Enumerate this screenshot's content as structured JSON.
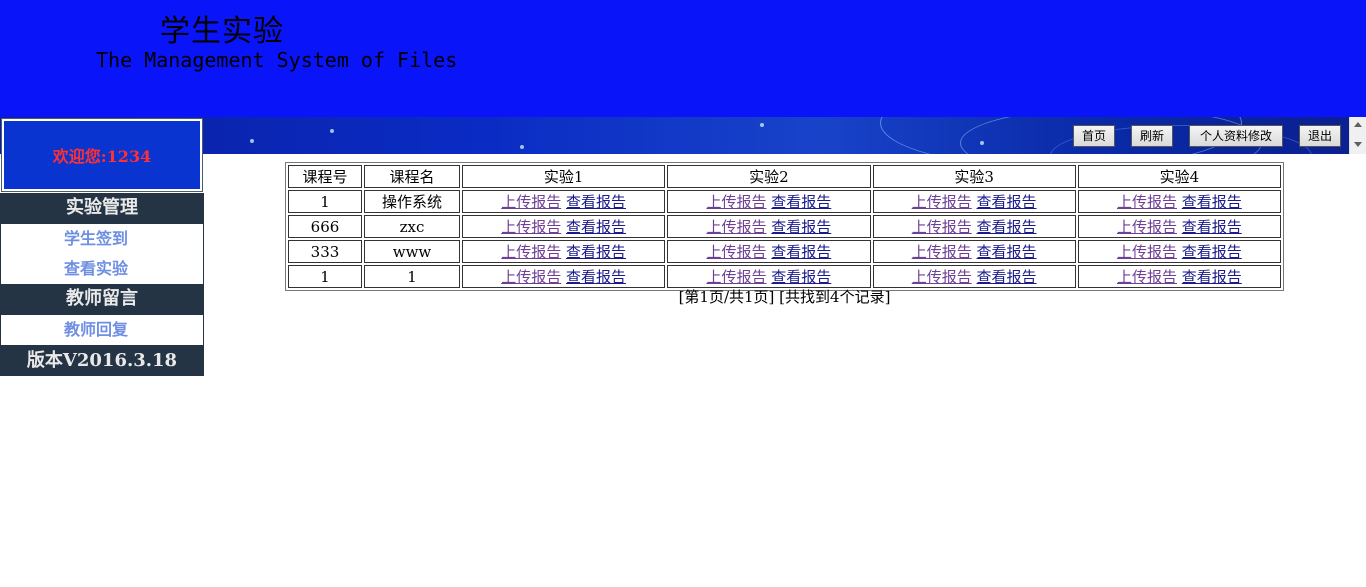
{
  "header": {
    "title_cn": "学生实验",
    "title_en": "The Management System of Files",
    "bg_color": "#0a14f8"
  },
  "toolbar": {
    "home": "首页",
    "refresh": "刷新",
    "profile": "个人资料修改",
    "logout": "退出"
  },
  "sidebar": {
    "welcome": "欢迎您:1234",
    "sections": [
      {
        "title": "实验管理",
        "items": [
          "学生签到",
          "查看实验"
        ]
      },
      {
        "title": "教师留言",
        "items": [
          "教师回复"
        ]
      }
    ],
    "version": "版本V2016.3.18"
  },
  "table": {
    "headers": [
      "课程号",
      "课程名",
      "实验1",
      "实验2",
      "实验3",
      "实验4"
    ],
    "upload_label": "上传报告",
    "view_label": "查看报告",
    "rows": [
      {
        "id": "1",
        "name": "操作系统"
      },
      {
        "id": "666",
        "name": "zxc"
      },
      {
        "id": "333",
        "name": "www"
      },
      {
        "id": "1",
        "name": "1"
      }
    ]
  },
  "pager": {
    "text": "[第1页/共1页] [共找到4个记录]"
  },
  "colors": {
    "sidebar_dark": "#243444",
    "menu_link": "#6f8fe3",
    "welcome_text": "#ff3030",
    "upload_link": "#6f3f96",
    "view_link": "#1a1a8c"
  }
}
